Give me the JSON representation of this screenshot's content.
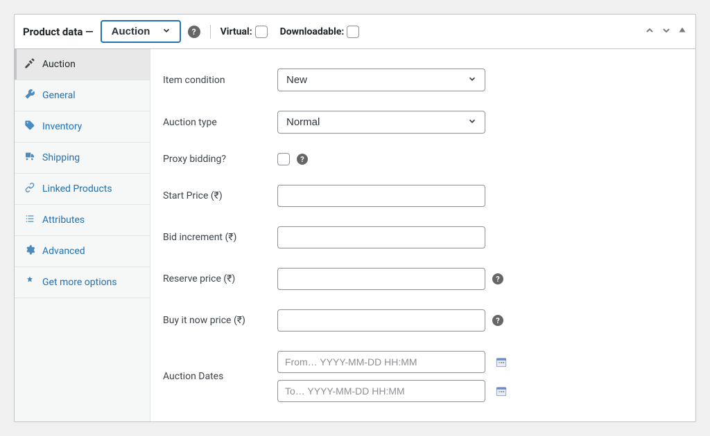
{
  "header": {
    "title": "Product data —",
    "product_type": "Auction",
    "virtual_label": "Virtual:",
    "downloadable_label": "Downloadable:"
  },
  "tabs": {
    "items": [
      {
        "label": "Auction",
        "icon": "hammer-icon",
        "active": true
      },
      {
        "label": "General",
        "icon": "wrench-icon",
        "active": false
      },
      {
        "label": "Inventory",
        "icon": "tag-icon",
        "active": false
      },
      {
        "label": "Shipping",
        "icon": "truck-icon",
        "active": false
      },
      {
        "label": "Linked Products",
        "icon": "link-icon",
        "active": false
      },
      {
        "label": "Attributes",
        "icon": "list-icon",
        "active": false
      },
      {
        "label": "Advanced",
        "icon": "gear-icon",
        "active": false
      },
      {
        "label": "Get more options",
        "icon": "plus-icon",
        "active": false
      }
    ]
  },
  "fields": {
    "item_condition": {
      "label": "Item condition",
      "value": "New"
    },
    "auction_type": {
      "label": "Auction type",
      "value": "Normal"
    },
    "proxy_bidding": {
      "label": "Proxy bidding?",
      "checked": false
    },
    "start_price": {
      "label": "Start Price (₹)",
      "value": ""
    },
    "bid_increment": {
      "label": "Bid increment (₹)",
      "value": ""
    },
    "reserve_price": {
      "label": "Reserve price (₹)",
      "value": ""
    },
    "buy_now_price": {
      "label": "Buy it now price (₹)",
      "value": ""
    },
    "auction_dates": {
      "label": "Auction Dates",
      "from_placeholder": "From… YYYY-MM-DD HH:MM",
      "to_placeholder": "To… YYYY-MM-DD HH:MM"
    }
  }
}
